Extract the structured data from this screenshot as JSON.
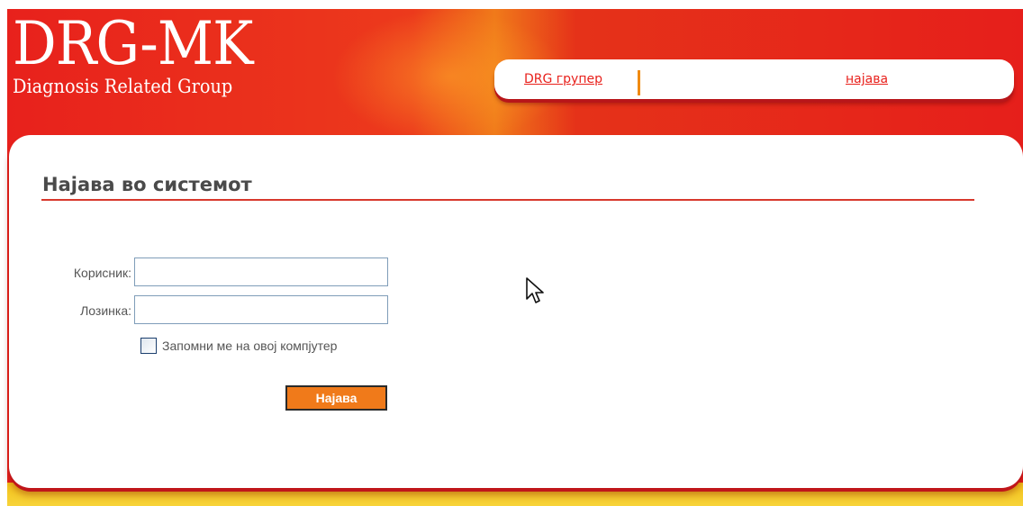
{
  "logo": {
    "title": "DRG-MK",
    "subtitle": "Diagnosis Related Group"
  },
  "nav": {
    "items": [
      {
        "label": "DRG групер"
      },
      {
        "label": "најава"
      }
    ]
  },
  "login": {
    "heading": "Најава во системот",
    "username_label": "Корисник:",
    "username_value": "",
    "password_label": "Лозинка:",
    "password_value": "",
    "remember_label": "Запомни ме на овој компјутер",
    "remember_checked": false,
    "submit_label": "Најава"
  },
  "colors": {
    "brand_red": "#e8211c",
    "accent_orange": "#f07a1a",
    "footer_yellow": "#f4c21a"
  },
  "icons": {
    "cursor": "mouse-pointer-icon"
  }
}
